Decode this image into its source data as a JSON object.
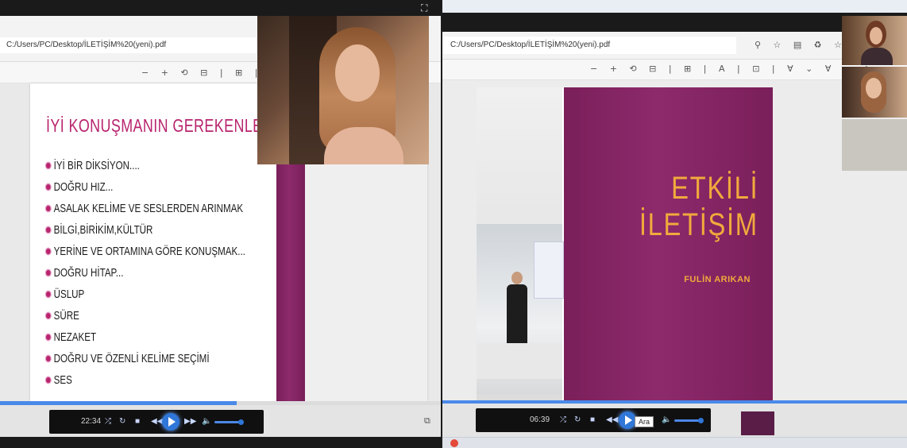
{
  "left": {
    "address": "C:/Users/PC/Desktop/İLETİŞİM%20(yeni).pdf",
    "window_chars": "—  +",
    "toolbar": "− + ⟲ ⊟ | ⊞ | A ⓘ",
    "slide": {
      "title": "İYİ KONUŞMANIN GEREKENLERİ",
      "bullets": [
        "İYİ BİR DİKSİYON....",
        "DOĞRU HIZ...",
        "ASALAK KELİME VE SESLERDEN ARINMAK",
        "BİLGİ,BİRİKİM,KÜLTÜR",
        "YERİNE VE ORTAMINA GÖRE KONUŞMAK...",
        "DOĞRU HİTAP...",
        "ÜSLUP",
        "SÜRE",
        "NEZAKET",
        "DOĞRU VE ÖZENLİ KELİME SEÇİMİ",
        "SES"
      ]
    },
    "player": {
      "time": "22:34"
    }
  },
  "right": {
    "address": "C:/Users/PC/Desktop/İLETİŞİM%20(yeni).pdf",
    "toolbar": "− + ⟲ ⊟ | ⊞ | A | ⊡ | ∀ ⌄ ∀ ⌄ ◇",
    "slide": {
      "title_line1": "ETKİLİ",
      "title_line2": "İLETİŞİM",
      "author": "FULİN ARIKAN"
    },
    "player": {
      "time": "06:39",
      "tooltip": "Ara"
    }
  },
  "colors": {
    "slide_title": "#b8246e",
    "slide_accent": "#7a1f5a",
    "title_orange": "#f1a93c",
    "player_accent": "#2f77d8"
  }
}
